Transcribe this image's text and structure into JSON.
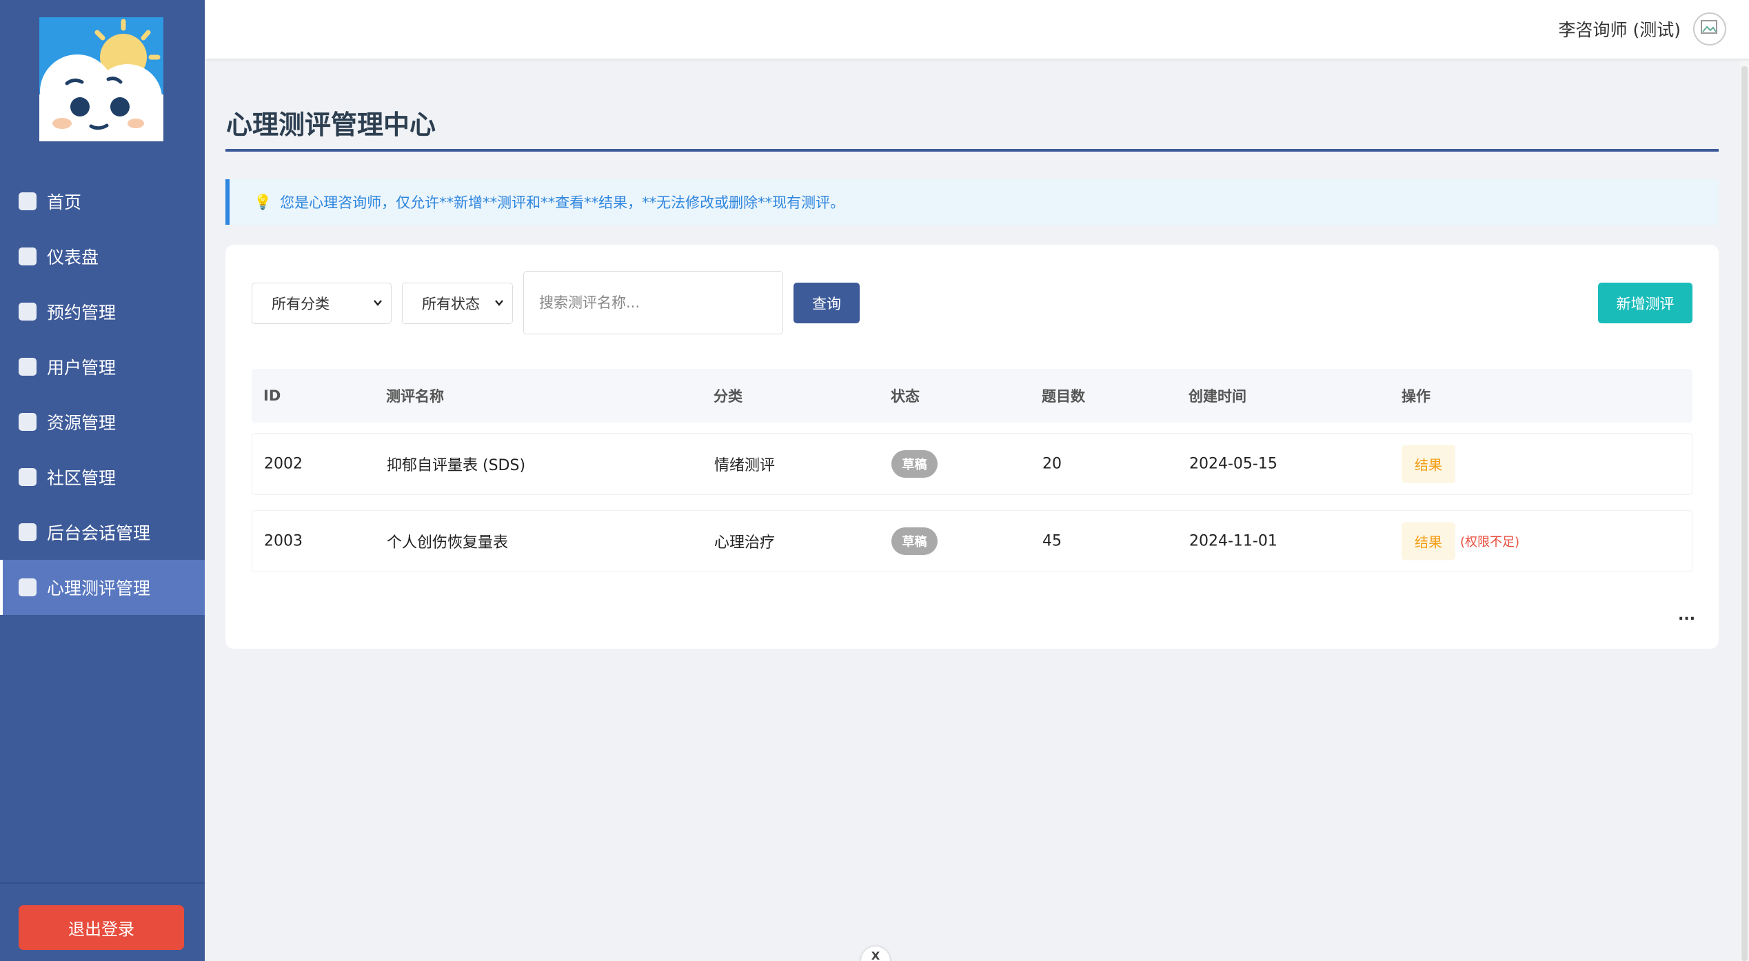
{
  "sidebar": {
    "items": [
      {
        "label": "首页"
      },
      {
        "label": "仪表盘"
      },
      {
        "label": "预约管理"
      },
      {
        "label": "用户管理"
      },
      {
        "label": "资源管理"
      },
      {
        "label": "社区管理"
      },
      {
        "label": "后台会话管理"
      },
      {
        "label": "心理测评管理"
      }
    ],
    "active_index": 7,
    "logout_label": "退出登录"
  },
  "header": {
    "user_name": "李咨询师 (测试)"
  },
  "main": {
    "title": "心理测评管理中心",
    "notice": "您是心理咨询师，仅允许**新增**测评和**查看**结果，**无法修改或删除**现有测评。",
    "filters": {
      "category": "所有分类",
      "status": "所有状态",
      "search_placeholder": "搜索测评名称...",
      "query_label": "查询",
      "add_label": "新增测评"
    },
    "table": {
      "headers": {
        "id": "ID",
        "name": "测评名称",
        "category": "分类",
        "status": "状态",
        "count": "题目数",
        "created": "创建时间",
        "ops": "操作"
      },
      "rows": [
        {
          "id": "2002",
          "name": "抑郁自评量表 (SDS)",
          "category": "情绪测评",
          "status": "草稿",
          "count": "20",
          "created": "2024-05-15",
          "action": "结果",
          "note": ""
        },
        {
          "id": "2003",
          "name": "个人创伤恢复量表",
          "category": "心理治疗",
          "status": "草稿",
          "count": "45",
          "created": "2024-11-01",
          "action": "结果",
          "note": "(权限不足)"
        }
      ]
    },
    "pagination_more": "..."
  },
  "colors": {
    "sidebar_bg": "#3d5a99",
    "sidebar_active": "#5a78c0",
    "logout": "#e74c3c",
    "add_button": "#1abcba",
    "query_button": "#3d5a99",
    "notice_text": "#2e86de",
    "draft_badge": "#a9a9a9",
    "result_text": "#f39c12"
  },
  "icons": {
    "logo": "cloud-sun-mascot-icon",
    "notice": "lightbulb-icon",
    "dropdown": "chevron-down-icon",
    "floating": "close-icon"
  }
}
